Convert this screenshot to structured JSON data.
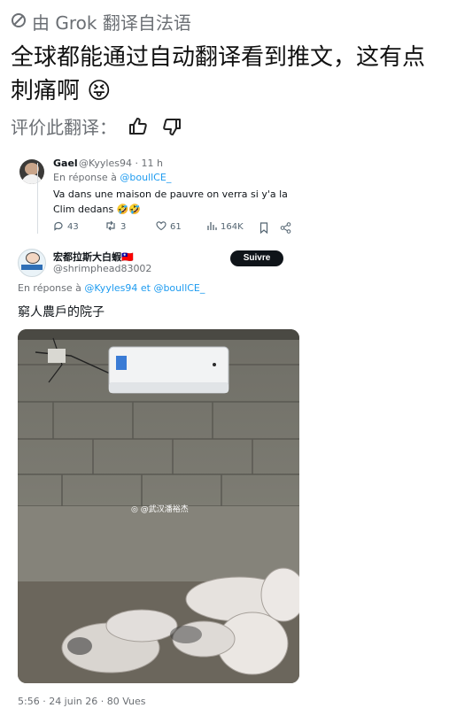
{
  "translation": {
    "label": "由 Grok 翻译自法语"
  },
  "post": {
    "text": "全球都能通过自动翻译看到推文，这有点刺痛啊 😝"
  },
  "rating": {
    "label": "评价此翻译："
  },
  "embed": {
    "reply1": {
      "name": "Gael",
      "handle": "@Kyyles94 · 11 h",
      "reply_prefix": "En réponse à ",
      "reply_to": "@boullCE_",
      "text": "Va dans une maison de pauvre on verra si y'a la Clim dedans 🤣🤣",
      "stats": {
        "replies": "43",
        "reposts": "3",
        "likes": "61",
        "views": "164K"
      }
    },
    "reply2": {
      "name": "宏都拉斯大白蝦🇹🇼",
      "handle": "@shrimphead83002",
      "follow_label": "Suivre",
      "reply_prefix": "En réponse à ",
      "reply_to": "@Kyyles94 et @boullCE_",
      "text": "窮人農戶的院子",
      "watermark": "@武汉潘裕杰",
      "timestamp": "5:56 · 24 juin 26 · 80 Vues"
    }
  }
}
